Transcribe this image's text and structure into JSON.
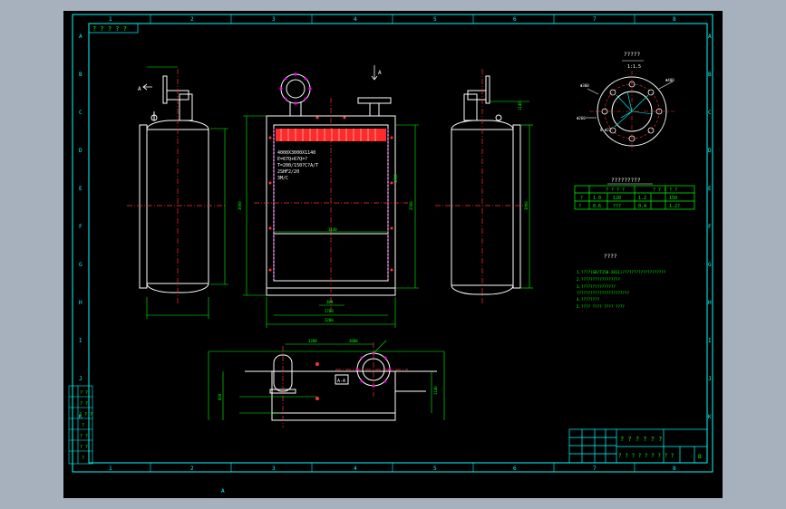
{
  "colors": {
    "paper": "#000000",
    "background": "#a7b0bd",
    "frame": "#00ffff",
    "outline": "#ffffff",
    "center_line": "#ff3030",
    "dimension": "#00ff00",
    "flange": "#ff00ff",
    "fin_fill": "#ff2a2a"
  },
  "border": {
    "columns": [
      "1",
      "2",
      "3",
      "4",
      "5",
      "6",
      "7",
      "8"
    ],
    "rows": [
      "A",
      "B",
      "C",
      "D",
      "E",
      "F",
      "G",
      "H",
      "I",
      "J",
      "K"
    ],
    "footer_mark": "A"
  },
  "views": {
    "side_left": {
      "arrow_label": "A"
    },
    "front": {
      "arrow_label": "A",
      "notes": [
        "4000X3000X1140",
        "E=67Q+67Q=?",
        "T=200/150?C?A/T",
        "2SHF2/20",
        "3M/C"
      ],
      "dims": [
        "1140",
        "3000",
        "2500",
        "2700",
        "300",
        "3200",
        "1500"
      ]
    },
    "side_right": {
      "dims": [
        "3000",
        "1140"
      ]
    },
    "plan": {
      "dims": [
        "3200",
        "3000",
        "800",
        "1140"
      ],
      "tag": "A-A"
    }
  },
  "flange_detail": {
    "title": "?????",
    "subtitle": "1:1.5",
    "dims": [
      "Φ400",
      "Φ300",
      "Φ260",
      "8-Φ22"
    ]
  },
  "param_table": {
    "title": "?????????",
    "headers": [
      "?",
      "? ? ? ?",
      "? ? ? ? ?"
    ],
    "rows": [
      [
        "?",
        "1.0",
        "120",
        "1.2",
        "150"
      ],
      [
        "?",
        "0.6",
        "???",
        "0.4",
        "1.2?"
      ]
    ]
  },
  "tech_notes": {
    "title": "????",
    "lines": [
      "1.????(GB/T150-2011)???????????????????",
      "2.?????????????????",
      "3.???????????????",
      "  ???????????????????????",
      "4.????????",
      "5.???? ???? ???? ????"
    ]
  },
  "title_block": {
    "project": "? ? ? ? ? ?",
    "drawing": "? ? ? ? ? ? ? ? ?",
    "code": "B"
  },
  "rev_table_left": {
    "rows": [
      "? ?",
      "? ?",
      "? ? ?",
      "?",
      "? ?",
      "? ?",
      "?"
    ]
  },
  "top_left_stamp": "? ? ? ? ?"
}
